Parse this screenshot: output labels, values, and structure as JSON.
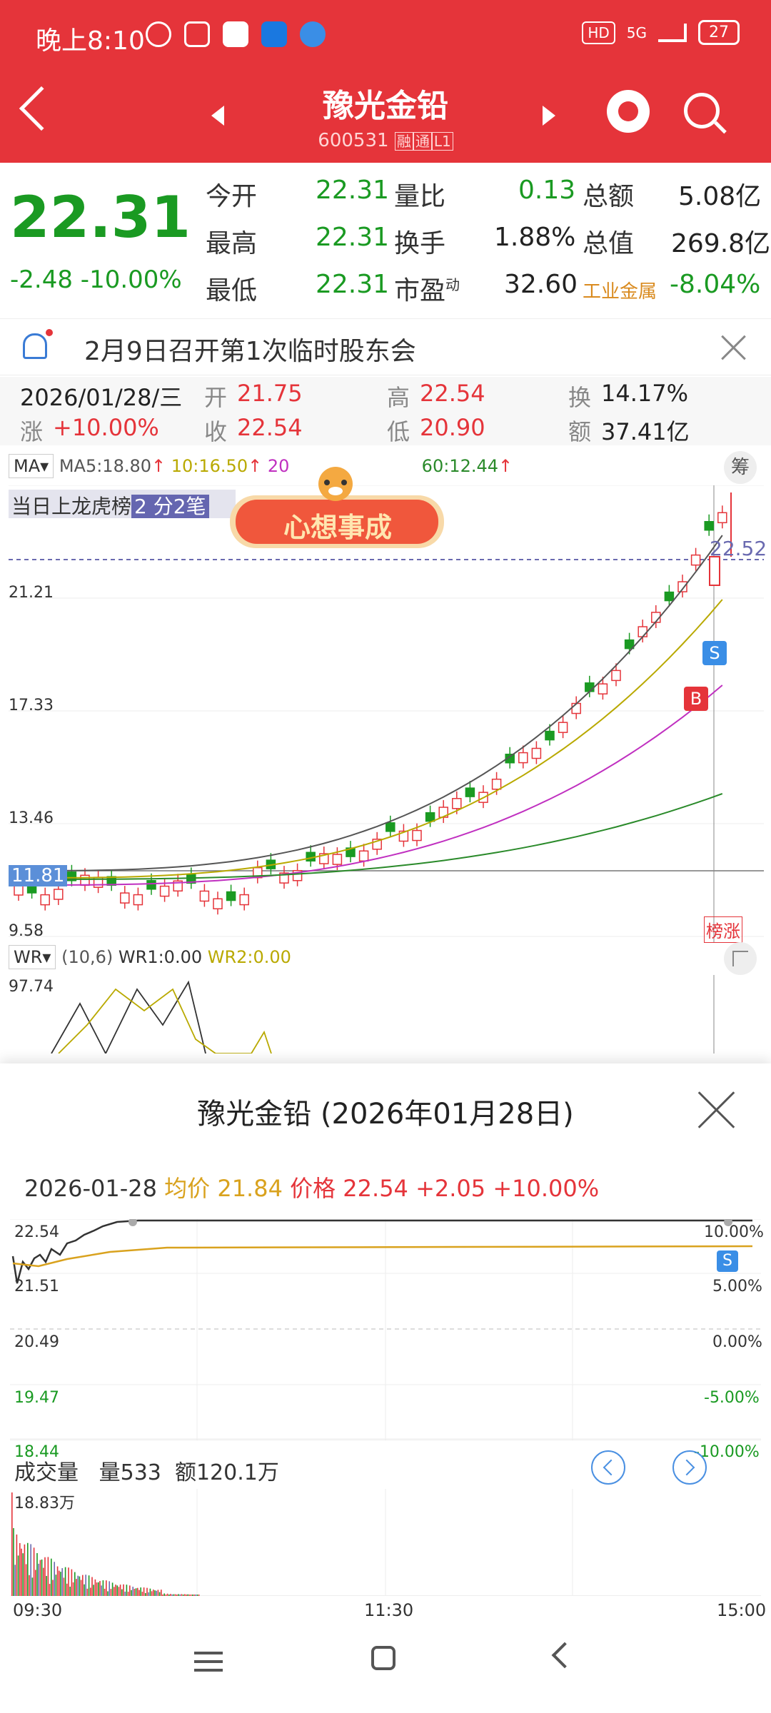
{
  "status_bar": {
    "time": "晚上8:10",
    "network": "5G",
    "hd": "HD",
    "battery": "27"
  },
  "header": {
    "title": "豫光金铅",
    "code": "600531",
    "tags": [
      "融",
      "通",
      "L1"
    ]
  },
  "quote": {
    "price": "22.31",
    "change": "-2.48",
    "change_pct": "-10.00%",
    "fields": [
      {
        "label": "今开",
        "value": "22.31"
      },
      {
        "label": "最高",
        "value": "22.31"
      },
      {
        "label": "最低",
        "value": "22.31"
      },
      {
        "label": "量比",
        "value": "0.13"
      },
      {
        "label": "换手",
        "value": "1.88%"
      },
      {
        "label": "市盈",
        "sup": "动",
        "value": "32.60"
      },
      {
        "label": "总额",
        "value": "5.08亿"
      },
      {
        "label": "总值",
        "value": "269.8亿"
      },
      {
        "label": "工业金属",
        "value": "-8.04%"
      }
    ]
  },
  "notice": {
    "text": "2月9日召开第1次临时股东会"
  },
  "day_info": {
    "date": "2026/01/28/三",
    "open_label": "开",
    "open": "21.75",
    "high_label": "高",
    "high": "22.54",
    "turnover_label": "换",
    "turnover": "14.17%",
    "rise_label": "涨",
    "rise": "+10.00%",
    "close_label": "收",
    "close": "22.54",
    "low_label": "低",
    "low": "20.90",
    "amount_label": "额",
    "amount": "37.41亿"
  },
  "ma_bar": {
    "selector": "MA",
    "ma5": "MA5:18.80",
    "ma10": "10:16.50",
    "ma20": "20",
    "ma60": "60:12.44",
    "chip_btn": "筹"
  },
  "dragon_tiger": {
    "text": "当日上龙虎榜",
    "count": "2 分2笔"
  },
  "badge": {
    "text": "心想事成"
  },
  "kchart": {
    "y_labels": [
      "21.21",
      "17.33",
      "13.46",
      "9.58"
    ],
    "price_label": "22.52",
    "current_label": "11.81",
    "bottom_tag": "榜涨",
    "sell_tag": "S",
    "buy_tag": "B"
  },
  "wr_bar": {
    "selector": "WR",
    "params": "(10,6)",
    "wr1": "WR1:0.00",
    "wr2": "WR2:0.00",
    "y_label": "97.74"
  },
  "sheet": {
    "title": "豫光金铅 (2026年01月28日)",
    "date": "2026-01-28",
    "avg_label": "均价",
    "avg": "21.84",
    "price_label": "价格",
    "price": "22.54",
    "change": "+2.05",
    "change_pct": "+10.00%",
    "y_left": [
      "22.54",
      "21.51",
      "20.49",
      "19.47",
      "18.44"
    ],
    "y_right": [
      "10.00%",
      "5.00%",
      "0.00%",
      "-5.00%",
      "-10.00%"
    ],
    "sell_tag": "S",
    "volume_label": "成交量",
    "volume": "量533",
    "amount": "额120.1万",
    "vol_max": "18.83万",
    "times": [
      "09:30",
      "11:30",
      "15:00"
    ]
  },
  "colors": {
    "red": "#e5343a",
    "green": "#1a9a22",
    "gold": "#d9a21e",
    "ma10": "#b9a900",
    "ma20": "#c030c0",
    "ma60": "#2a8a2a"
  },
  "icons": [
    "back-arrow-icon",
    "prev-icon",
    "next-icon",
    "robot-icon",
    "search-icon",
    "bell-icon",
    "close-icon",
    "expand-icon"
  ]
}
